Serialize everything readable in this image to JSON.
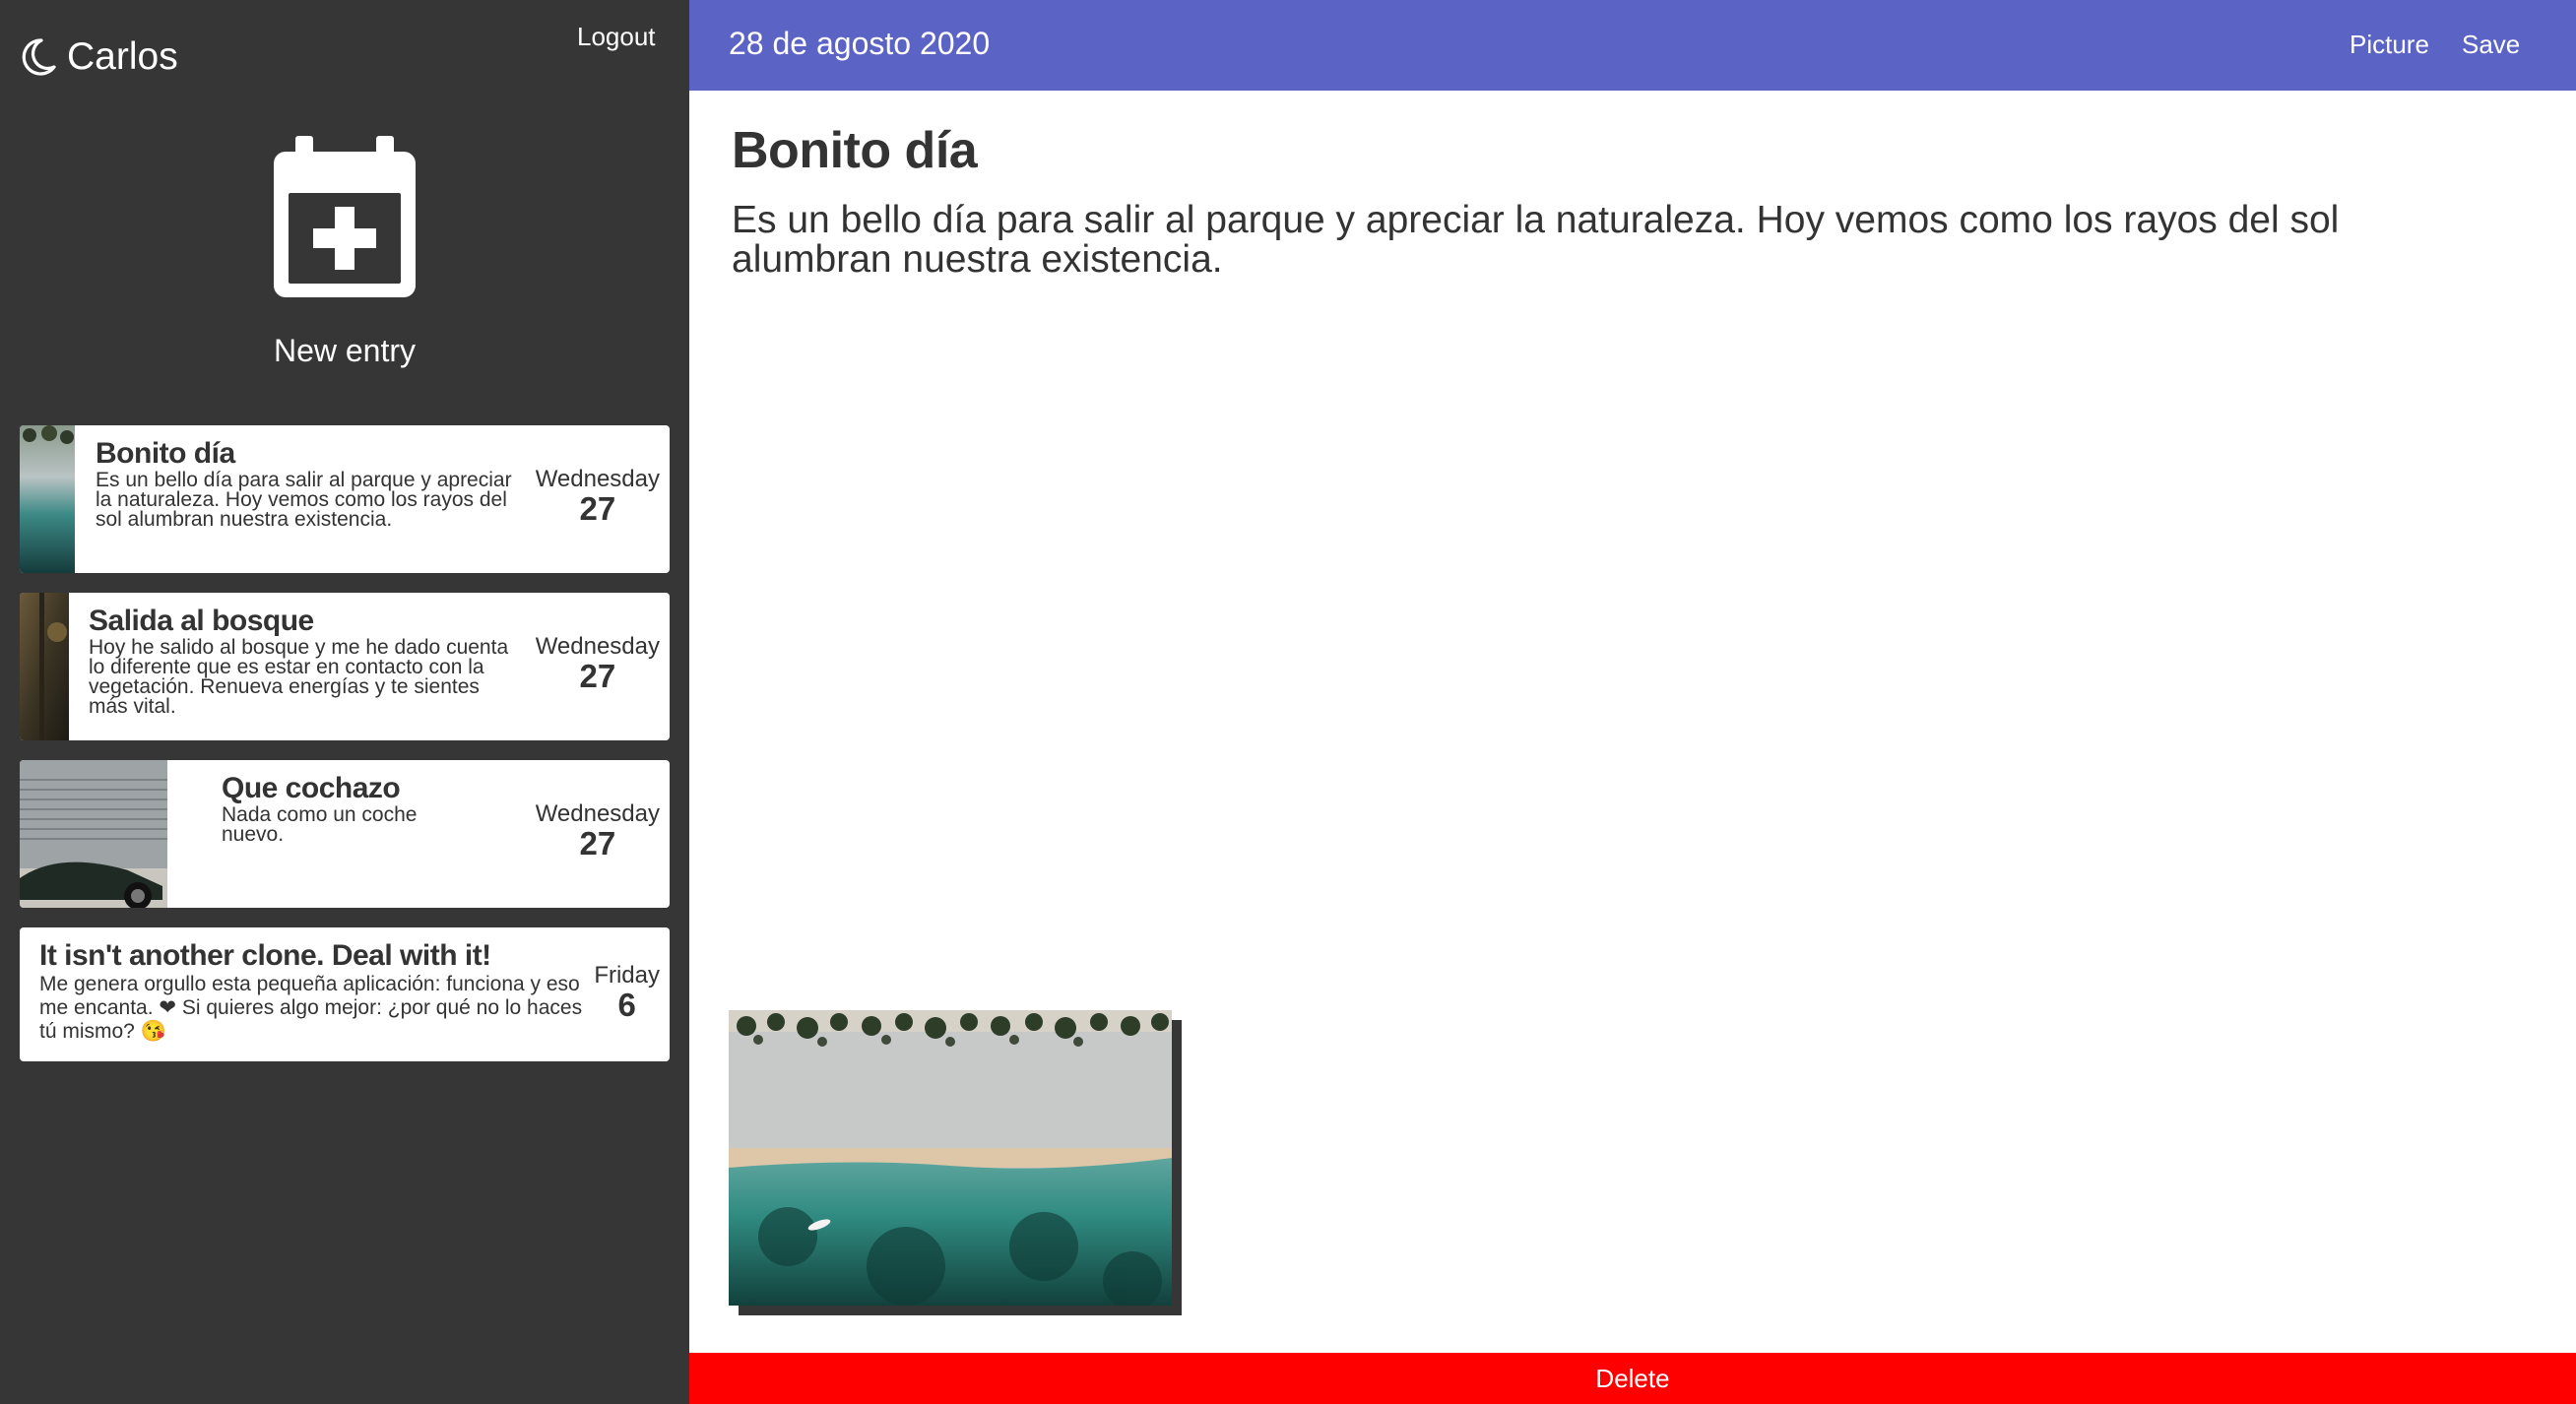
{
  "sidebar": {
    "user_name": "Carlos",
    "logout_label": "Logout",
    "new_entry_label": "New entry",
    "entries": [
      {
        "title": "Bonito día",
        "body": "Es un bello día para salir al parque y apreciar la naturaleza. Hoy vemos como los rayos del sol alumbran nuestra existencia.",
        "weekday": "Wednesday",
        "day": "27"
      },
      {
        "title": "Salida al bosque",
        "body": "Hoy he salido al bosque y me he dado cuenta lo diferente que es estar en contacto con la vegetación. Renueva energías y te sientes más vital.",
        "weekday": "Wednesday",
        "day": "27"
      },
      {
        "title": "Que cochazo",
        "body": "Nada como un coche nuevo.",
        "weekday": "Wednesday",
        "day": "27"
      },
      {
        "title": "It isn't another clone. Deal with it!",
        "body": "Me genera orgullo esta pequeña aplicación: funciona y eso me encanta. ❤ Si quieres algo mejor: ¿por qué no lo haces tú mismo? 😘",
        "weekday": "Friday",
        "day": "6"
      }
    ]
  },
  "main": {
    "date_label": "28 de agosto 2020",
    "picture_label": "Picture",
    "save_label": "Save",
    "entry_title": "Bonito día",
    "entry_body": "Es un bello día para salir al parque y apreciar la naturaleza. Hoy vemos como los rayos del sol alumbran nuestra existencia.",
    "delete_label": "Delete"
  },
  "colors": {
    "sidebar_bg": "#363636",
    "topbar_bg": "#5b64c4",
    "delete_bg": "#ff0000"
  },
  "icons": {
    "theme": "moon-icon",
    "new_entry": "calendar-plus-icon"
  }
}
